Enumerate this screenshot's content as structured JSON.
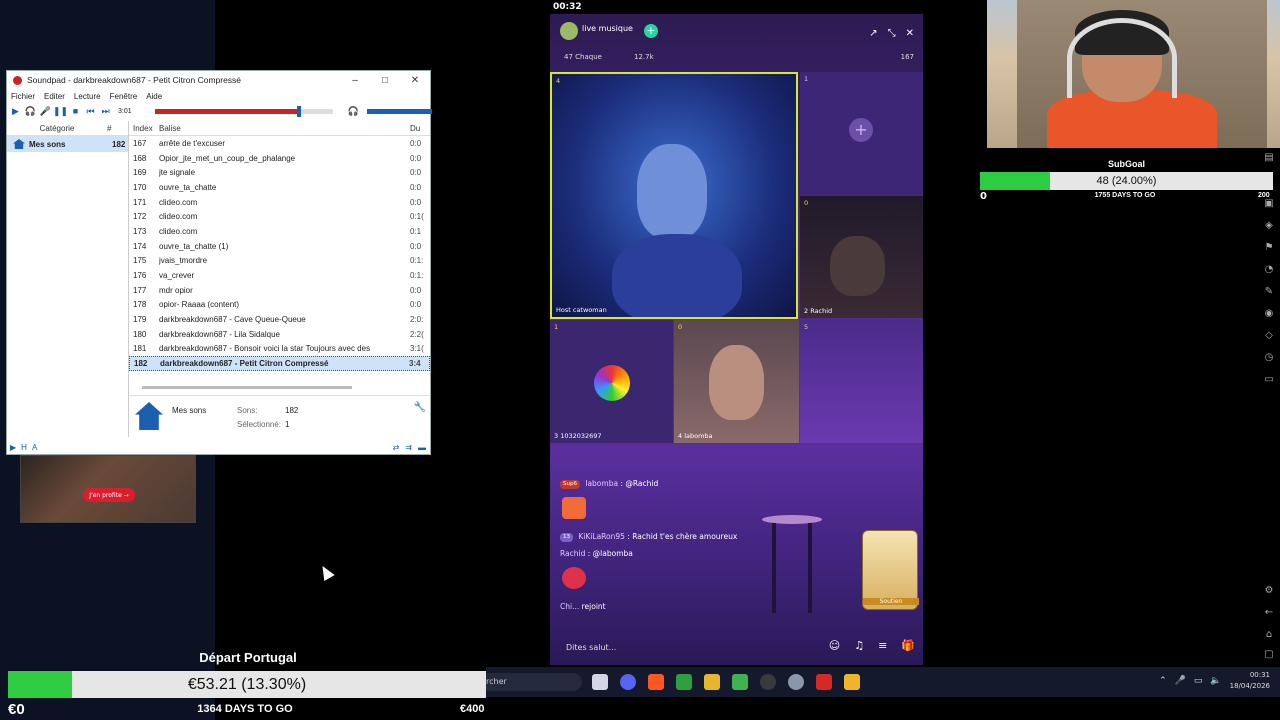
{
  "soundpad": {
    "title": "Soundpad - darkbreakdown687 - Petit Citron Compressé",
    "menu": [
      "Fichier",
      "Editer",
      "Lecture",
      "Fenêtre",
      "Aide"
    ],
    "time": "3:01",
    "progress_fraction": 0.8,
    "category_header": "Catégorie",
    "category_count_header": "#",
    "category": {
      "name": "Mes sons",
      "count": "182"
    },
    "columns": {
      "index": "Index",
      "tag": "Balise",
      "duration": "Du"
    },
    "rows": [
      {
        "index": "167",
        "name": "arrête de t'excuser",
        "dur": "0:0"
      },
      {
        "index": "168",
        "name": "Opior_jte_met_un_coup_de_phalange",
        "dur": "0:0"
      },
      {
        "index": "169",
        "name": "jte signale",
        "dur": "0:0"
      },
      {
        "index": "170",
        "name": "ouvre_ta_chatte",
        "dur": "0:0"
      },
      {
        "index": "171",
        "name": "clideo.com",
        "dur": "0:0"
      },
      {
        "index": "172",
        "name": "clideo.com",
        "dur": "0:1("
      },
      {
        "index": "173",
        "name": "clideo.com",
        "dur": "0:1"
      },
      {
        "index": "174",
        "name": "ouvre_ta_chatte (1)",
        "dur": "0:0"
      },
      {
        "index": "175",
        "name": "jvais_tmordre",
        "dur": "0:1:"
      },
      {
        "index": "176",
        "name": "va_crever",
        "dur": "0:1:"
      },
      {
        "index": "177",
        "name": "mdr opior",
        "dur": "0:0"
      },
      {
        "index": "178",
        "name": "opior- Raaaa (content)",
        "dur": "0:0"
      },
      {
        "index": "179",
        "name": "darkbreakdown687 - Cave Queue-Queue",
        "dur": "2:0:"
      },
      {
        "index": "180",
        "name": "darkbreakdown687 - Lila Sidalque",
        "dur": "2:2("
      },
      {
        "index": "181",
        "name": "darkbreakdown687 - Bonsoir voici la star Toujours avec des",
        "dur": "3:1("
      },
      {
        "index": "182",
        "name": "darkbreakdown687 - Petit Citron Compressé",
        "dur": "3:4"
      }
    ],
    "info": {
      "title": "Mes sons",
      "sons_label": "Sons:",
      "sons_value": "182",
      "sel_label": "Sélectionné:",
      "sel_value": "1"
    }
  },
  "thumb": {
    "button": "J'en profite →"
  },
  "main_goal": {
    "title": "Départ Portugal",
    "percent_text": "€53.21 (13.30%)",
    "fraction": 0.133,
    "min": "€0",
    "days": "1364 DAYS TO GO",
    "max": "€400"
  },
  "taskbar": {
    "search": "rcher",
    "time": "00:31",
    "date": "18/04/2026"
  },
  "phone": {
    "status_time": "00:32",
    "room_name": "live musique",
    "stat1": "47 Chaque",
    "stat2": "12.7k",
    "viewers": "167",
    "tiles": {
      "t1_label": "Host catwoman",
      "t1_count": "4",
      "t2_num": "1",
      "t3_label": "2  Rachid",
      "t3_count": "0",
      "t4_label": "3  1032032697",
      "t4_count": "1",
      "t5_label": "4  labomba",
      "t5_count": "0",
      "t6_num": "5"
    },
    "chat": [
      {
        "badge": "Sup6",
        "user": "labomba",
        "text": ": @Rachid"
      },
      {
        "badge": "13",
        "user": "KiKiLaRon95",
        "text": ": Rachid t'es chère amoureux"
      },
      {
        "badge": "",
        "user": "Rachid",
        "text": ": @labomba"
      },
      {
        "badge": "",
        "user": "Chi...",
        "text": "rejoint"
      }
    ],
    "input_placeholder": "Dites salut...",
    "gift_label": "Soutien"
  },
  "sub_goal": {
    "title": "SubGoal",
    "percent_text": "48 (24.00%)",
    "fraction": 0.24,
    "min": "0",
    "days": "1755 DAYS TO GO",
    "max": "200"
  },
  "colors": {
    "accent": "#1a5fb0",
    "goal_fill": "#2ecc40",
    "phone_bg": "#4d2a86"
  }
}
